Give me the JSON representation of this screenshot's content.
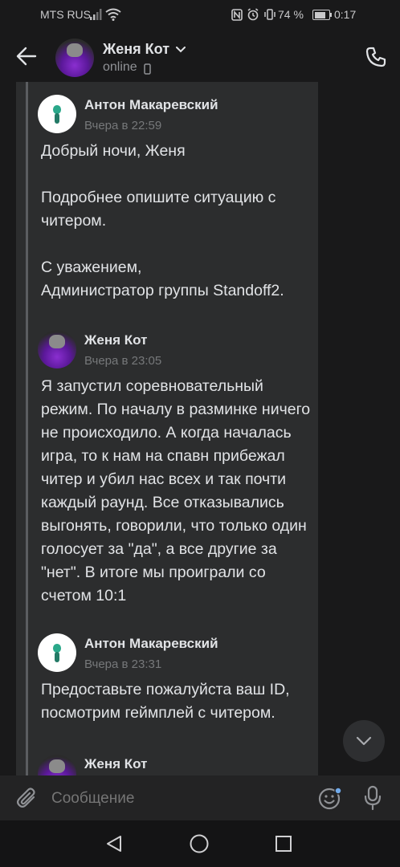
{
  "status_bar": {
    "carrier": "MTS RUS",
    "battery": "74 %",
    "time": "0:17"
  },
  "header": {
    "contact_name": "Женя Кот",
    "status": "online"
  },
  "messages": [
    {
      "author": "Антон Макаревский",
      "time": "Вчера в 22:59",
      "text": "Добрый ночи, Женя\n\nПодробнее опишите ситуацию с читером.\n\nС уважением,\nАдминистратор группы Standoff2."
    },
    {
      "author": "Женя Кот",
      "time": "Вчера в 23:05",
      "text": "Я запустил соревновательный режим. По началу в разминке ничего не происходило. А когда началась игра, то к нам на спавн прибежал читер и убил нас всех и так почти каждый раунд. Все  отказывались выгонять, говорили, что только один голосует за \"да\", а все другие за \"нет\". В итоге мы проиграли со счетом 10:1"
    },
    {
      "author": "Антон Макаревский",
      "time": "Вчера в 23:31",
      "text": "Предоставьте пожалуйста ваш ID, посмотрим геймплей с читером."
    },
    {
      "author": "Женя Кот",
      "time": "",
      "text": ""
    }
  ],
  "composer": {
    "placeholder": "Сообщение"
  },
  "colors": {
    "background": "#19191a",
    "bubble": "#2c2d2e",
    "accent": "#71aaeb"
  }
}
